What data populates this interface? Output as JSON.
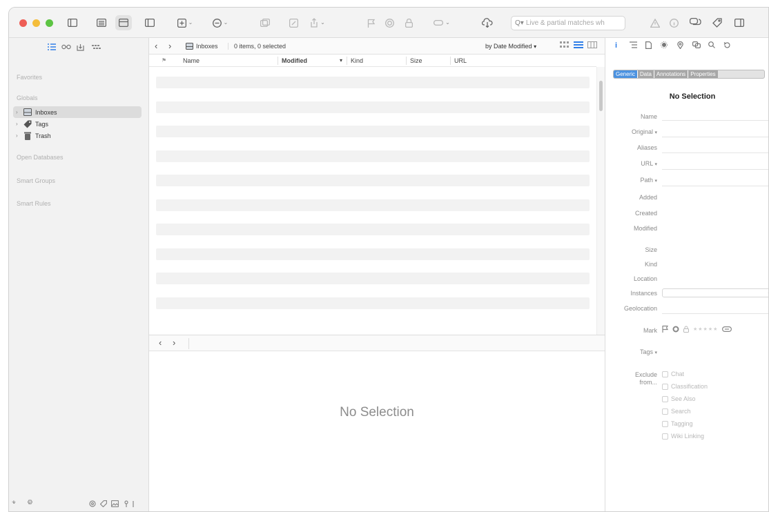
{
  "toolbar": {
    "search_placeholder": "Live & partial matches wh",
    "colors": {
      "close": "#ee5e56",
      "minimize": "#f4bd3b",
      "zoom": "#5dc443"
    }
  },
  "sidebar": {
    "tabs": [
      "list-icon",
      "glasses-icon",
      "tray-icon",
      "tag-cloud-icon"
    ],
    "sections": {
      "favorites": "Favorites",
      "globals": "Globals",
      "open_databases": "Open Databases",
      "smart_groups": "Smart Groups",
      "smart_rules": "Smart Rules"
    },
    "items": [
      {
        "label": "Inboxes",
        "icon": "inbox-icon",
        "selected": true
      },
      {
        "label": "Tags",
        "icon": "tag-icon",
        "selected": false
      },
      {
        "label": "Trash",
        "icon": "trash-icon",
        "selected": false
      }
    ],
    "bottom": {
      "add": "+",
      "add_chev": "⌄",
      "gear": "⚙",
      "gear_chev": "⌄"
    }
  },
  "main": {
    "breadcrumb": "Inboxes",
    "count": "0 items, 0 selected",
    "sort": "by Date Modified",
    "sort_chev": "▾",
    "nav_back": "‹",
    "nav_forward": "›",
    "columns": {
      "flag": "⚑",
      "name": "Name",
      "modified": "Modified",
      "kind": "Kind",
      "size": "Size",
      "url": "URL",
      "sort_arrow": "▾"
    },
    "row_count": 10,
    "preview_empty": "No Selection"
  },
  "inspector": {
    "segments": [
      "Generic",
      "Data",
      "Annotations",
      "Properties"
    ],
    "title": "No Selection",
    "fields": {
      "name": "Name",
      "original": "Original",
      "aliases": "Aliases",
      "url": "URL",
      "path": "Path",
      "added": "Added",
      "created": "Created",
      "modified": "Modified",
      "size": "Size",
      "kind": "Kind",
      "location": "Location",
      "instances": "Instances",
      "geolocation": "Geolocation",
      "mark": "Mark",
      "tags": "Tags",
      "exclude_line1": "Exclude",
      "exclude_line2": "from...",
      "dropdown_arrow": "▾",
      "select_arrow": "⌄"
    },
    "stars": "★★★★★",
    "exclude_options": [
      "Chat",
      "Classification",
      "See Also",
      "Search",
      "Tagging",
      "Wiki Linking"
    ]
  }
}
